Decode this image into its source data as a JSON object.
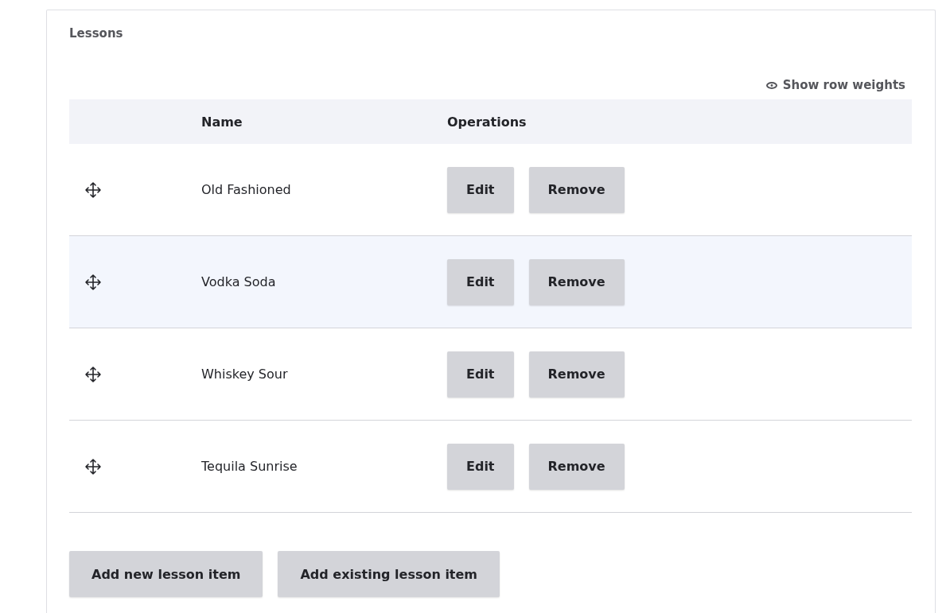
{
  "section": {
    "title": "Lessons"
  },
  "weights_toggle": {
    "label": "Show row weights"
  },
  "table": {
    "columns": [
      "Name",
      "Operations"
    ],
    "rows": [
      {
        "name": "Old Fashioned",
        "highlighted": false,
        "operations": [
          "Edit",
          "Remove"
        ]
      },
      {
        "name": "Vodka Soda",
        "highlighted": true,
        "operations": [
          "Edit",
          "Remove"
        ]
      },
      {
        "name": "Whiskey Sour",
        "highlighted": false,
        "operations": [
          "Edit",
          "Remove"
        ]
      },
      {
        "name": "Tequila Sunrise",
        "highlighted": false,
        "operations": [
          "Edit",
          "Remove"
        ]
      }
    ]
  },
  "actions": [
    "Add new lesson item",
    "Add existing lesson item"
  ]
}
